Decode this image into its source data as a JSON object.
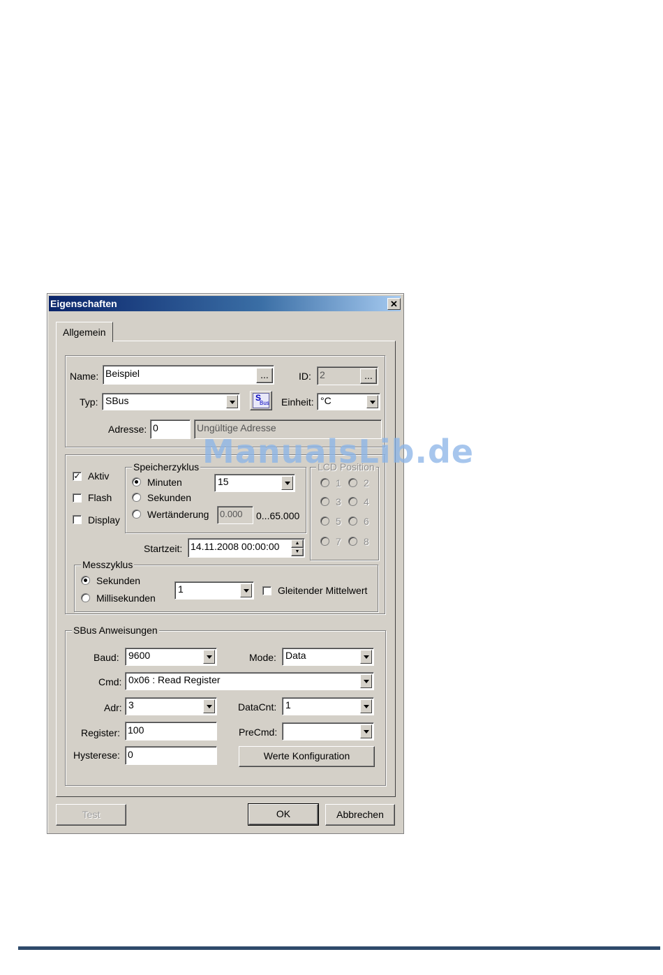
{
  "window": {
    "title": "Eigenschaften",
    "close_glyph": "✕"
  },
  "tabs": [
    {
      "label": "Allgemein"
    }
  ],
  "general": {
    "name_label": "Name:",
    "name_value": "Beispiel",
    "ellipsis": "...",
    "id_label": "ID:",
    "id_value": "2",
    "typ_label": "Typ:",
    "typ_value": "SBus",
    "einheit_label": "Einheit:",
    "einheit_value": "°C",
    "adresse_label": "Adresse:",
    "adresse_value": "0",
    "adresse_status": "Ungültige Adresse",
    "sbus_icon": {
      "top": "S",
      "bottom": "Bus"
    }
  },
  "flags": {
    "aktiv": "Aktiv",
    "flash": "Flash",
    "display": "Display"
  },
  "speicherzyklus": {
    "legend": "Speicherzyklus",
    "minuten": "Minuten",
    "sekunden": "Sekunden",
    "wertaenderung": "Wertänderung",
    "interval_value": "15",
    "wert_value": "0.000",
    "range": "0...65.000",
    "startzeit_label": "Startzeit:",
    "startzeit_value": "14.11.2008 00:00:00"
  },
  "lcd": {
    "legend": "LCD Position",
    "positions": [
      "1",
      "2",
      "3",
      "4",
      "5",
      "6",
      "7",
      "8"
    ]
  },
  "messzyklus": {
    "legend": "Messzyklus",
    "sekunden": "Sekunden",
    "millisekunden": "Millisekunden",
    "value": "1",
    "gleitender": "Gleitender Mittelwert"
  },
  "sbus": {
    "legend": "SBus Anweisungen",
    "baud_label": "Baud:",
    "baud_value": "9600",
    "mode_label": "Mode:",
    "mode_value": "Data",
    "cmd_label": "Cmd:",
    "cmd_value": "0x06 : Read Register",
    "adr_label": "Adr:",
    "adr_value": "3",
    "datacnt_label": "DataCnt:",
    "datacnt_value": "1",
    "register_label": "Register:",
    "register_value": "100",
    "precmd_label": "PreCmd:",
    "precmd_value": "",
    "hysterese_label": "Hysterese:",
    "hysterese_value": "0",
    "werte_button": "Werte Konfiguration"
  },
  "buttons": {
    "test": "Test",
    "ok": "OK",
    "abbrechen": "Abbrechen"
  },
  "watermark": "ManualsLib.de",
  "colors": {
    "dialog_bg": "#d4d0c8",
    "title_start": "#0a246a",
    "footer_rule": "#2f4a6b"
  }
}
